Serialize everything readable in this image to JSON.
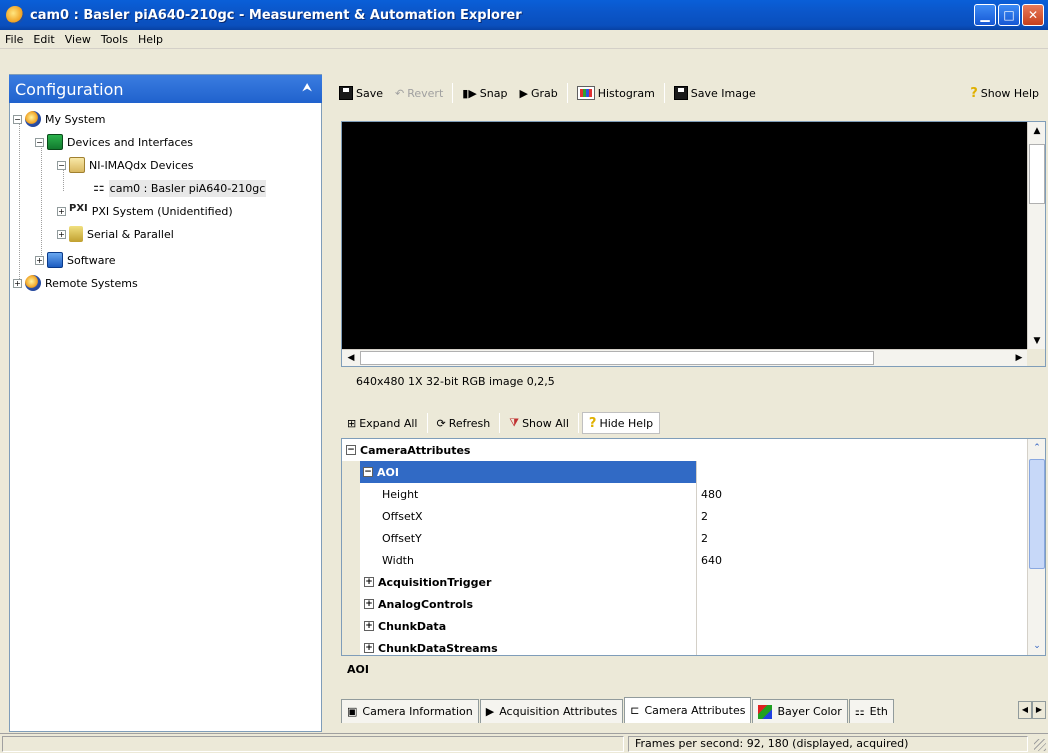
{
  "window": {
    "title": "cam0 : Basler piA640-210gc - Measurement & Automation Explorer"
  },
  "menu": [
    "File",
    "Edit",
    "View",
    "Tools",
    "Help"
  ],
  "left_panel": {
    "header": "Configuration",
    "tree": [
      {
        "label": "My System",
        "expander": "−",
        "icon": "globe-icon"
      },
      {
        "label": "Devices and Interfaces",
        "expander": "−",
        "icon": "devices-icon"
      },
      {
        "label": "NI-IMAQdx Devices",
        "expander": "−",
        "icon": "imaq-folder-icon"
      },
      {
        "label": "cam0 : Basler piA640-210gc",
        "expander": "",
        "icon": "camera-icon",
        "glyph": "⚏"
      },
      {
        "label": "PXI System (Unidentified)",
        "expander": "+",
        "icon": "pxi-icon",
        "glyph": "PXI"
      },
      {
        "label": "Serial & Parallel",
        "expander": "+",
        "icon": "serial-icon"
      },
      {
        "label": "Software",
        "expander": "+",
        "icon": "software-icon"
      },
      {
        "label": "Remote Systems",
        "expander": "+",
        "icon": "globe-icon"
      }
    ]
  },
  "toolbar": {
    "save": "Save",
    "revert": "Revert",
    "snap": "Snap",
    "grab": "Grab",
    "histogram": "Histogram",
    "save_image": "Save Image",
    "show_help": "Show Help"
  },
  "image_info": "640x480  1X  32-bit RGB image  0,2,5",
  "attr_toolbar": {
    "expand_all": "Expand All",
    "refresh": "Refresh",
    "show_all": "Show All",
    "hide_help": "Hide Help"
  },
  "grid": {
    "rows": [
      {
        "name": "CameraAttributes",
        "value": "",
        "kind": "section",
        "exp": "−"
      },
      {
        "name": "AOI",
        "value": "",
        "kind": "subsection-selected",
        "exp": "−"
      },
      {
        "name": "Height",
        "value": "480",
        "kind": "item"
      },
      {
        "name": "OffsetX",
        "value": "2",
        "kind": "item"
      },
      {
        "name": "OffsetY",
        "value": "2",
        "kind": "item"
      },
      {
        "name": "Width",
        "value": "640",
        "kind": "item"
      },
      {
        "name": "AcquisitionTrigger",
        "value": "",
        "kind": "subsection",
        "exp": "+"
      },
      {
        "name": "AnalogControls",
        "value": "",
        "kind": "subsection",
        "exp": "+"
      },
      {
        "name": "ChunkData",
        "value": "",
        "kind": "subsection",
        "exp": "+"
      },
      {
        "name": "ChunkDataStreams",
        "value": "",
        "kind": "subsection",
        "exp": "+"
      }
    ],
    "help_text": "AOI"
  },
  "tabs": [
    {
      "label": "Camera Information",
      "icon": "camera-info-icon",
      "active": false
    },
    {
      "label": "Acquisition Attributes",
      "icon": "play-icon",
      "active": false
    },
    {
      "label": "Camera Attributes",
      "icon": "camera-attr-icon",
      "active": true
    },
    {
      "label": "Bayer Color",
      "icon": "bayer-icon",
      "active": false
    },
    {
      "label": "Eth",
      "icon": "ethernet-icon",
      "active": false
    }
  ],
  "status": {
    "fps": "Frames per second: 92, 180 (displayed, acquired)"
  },
  "colors": {
    "title_bar": "#0a5fd8",
    "selection": "#316ac5",
    "chrome": "#ece9d8"
  }
}
